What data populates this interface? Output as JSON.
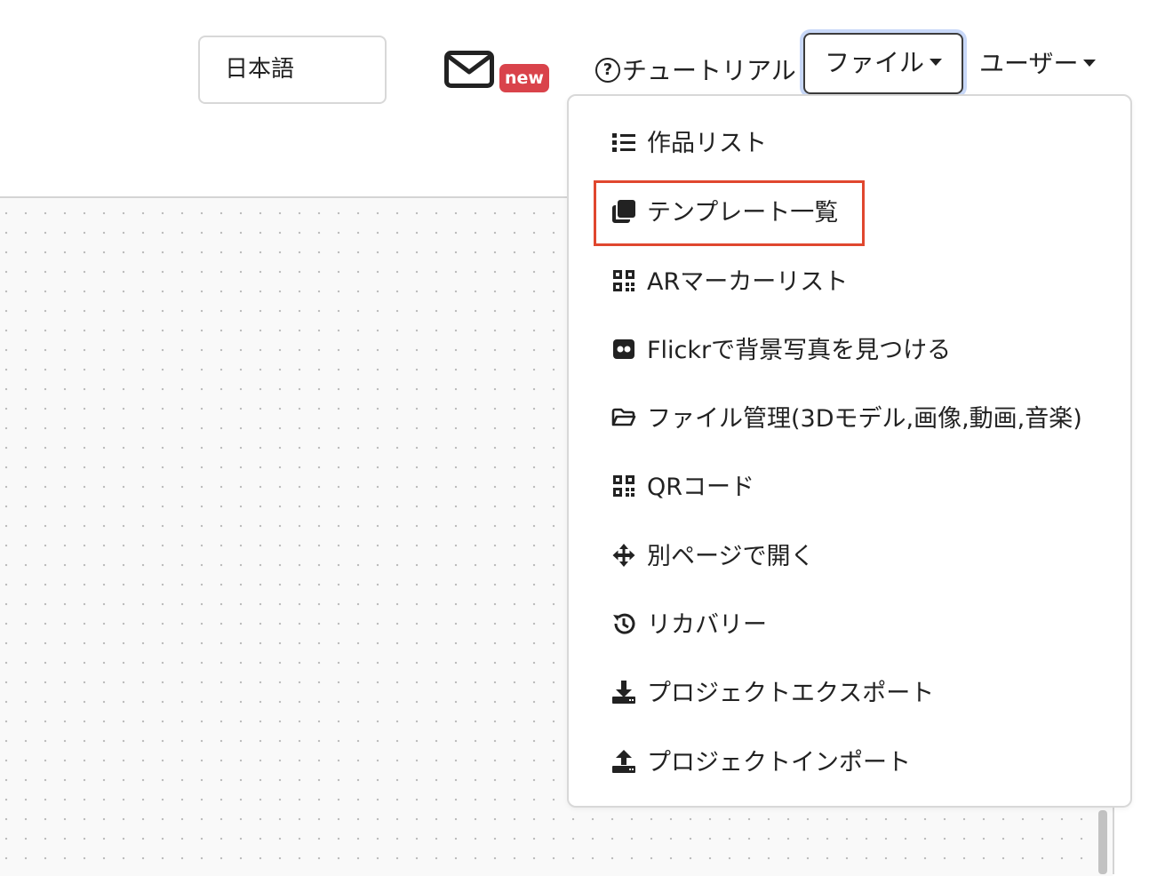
{
  "header": {
    "language_value": "日本語",
    "mail_badge": "new",
    "tutorial_label": "チュートリアル",
    "file_menu_label": "ファイル",
    "user_menu_label": "ユーザー"
  },
  "file_dropdown": {
    "items": [
      {
        "label": "作品リスト",
        "icon": "list-icon"
      },
      {
        "label": "テンプレート一覧",
        "icon": "clone-icon"
      },
      {
        "label": "ARマーカーリスト",
        "icon": "qrcode-icon"
      },
      {
        "label": "Flickrで背景写真を見つける",
        "icon": "flickr-icon"
      },
      {
        "label": "ファイル管理(3Dモデル,画像,動画,音楽)",
        "icon": "folder-open-icon"
      },
      {
        "label": "QRコード",
        "icon": "qrcode-icon"
      },
      {
        "label": "別ページで開く",
        "icon": "arrows-move-icon"
      },
      {
        "label": "リカバリー",
        "icon": "history-icon"
      },
      {
        "label": "プロジェクトエクスポート",
        "icon": "download-icon"
      },
      {
        "label": "プロジェクトインポート",
        "icon": "upload-icon"
      }
    ],
    "highlighted_index": 1
  },
  "colors": {
    "badge": "#d9434b",
    "highlight": "#e0472e",
    "focus_ring": "#c8d8f8"
  }
}
